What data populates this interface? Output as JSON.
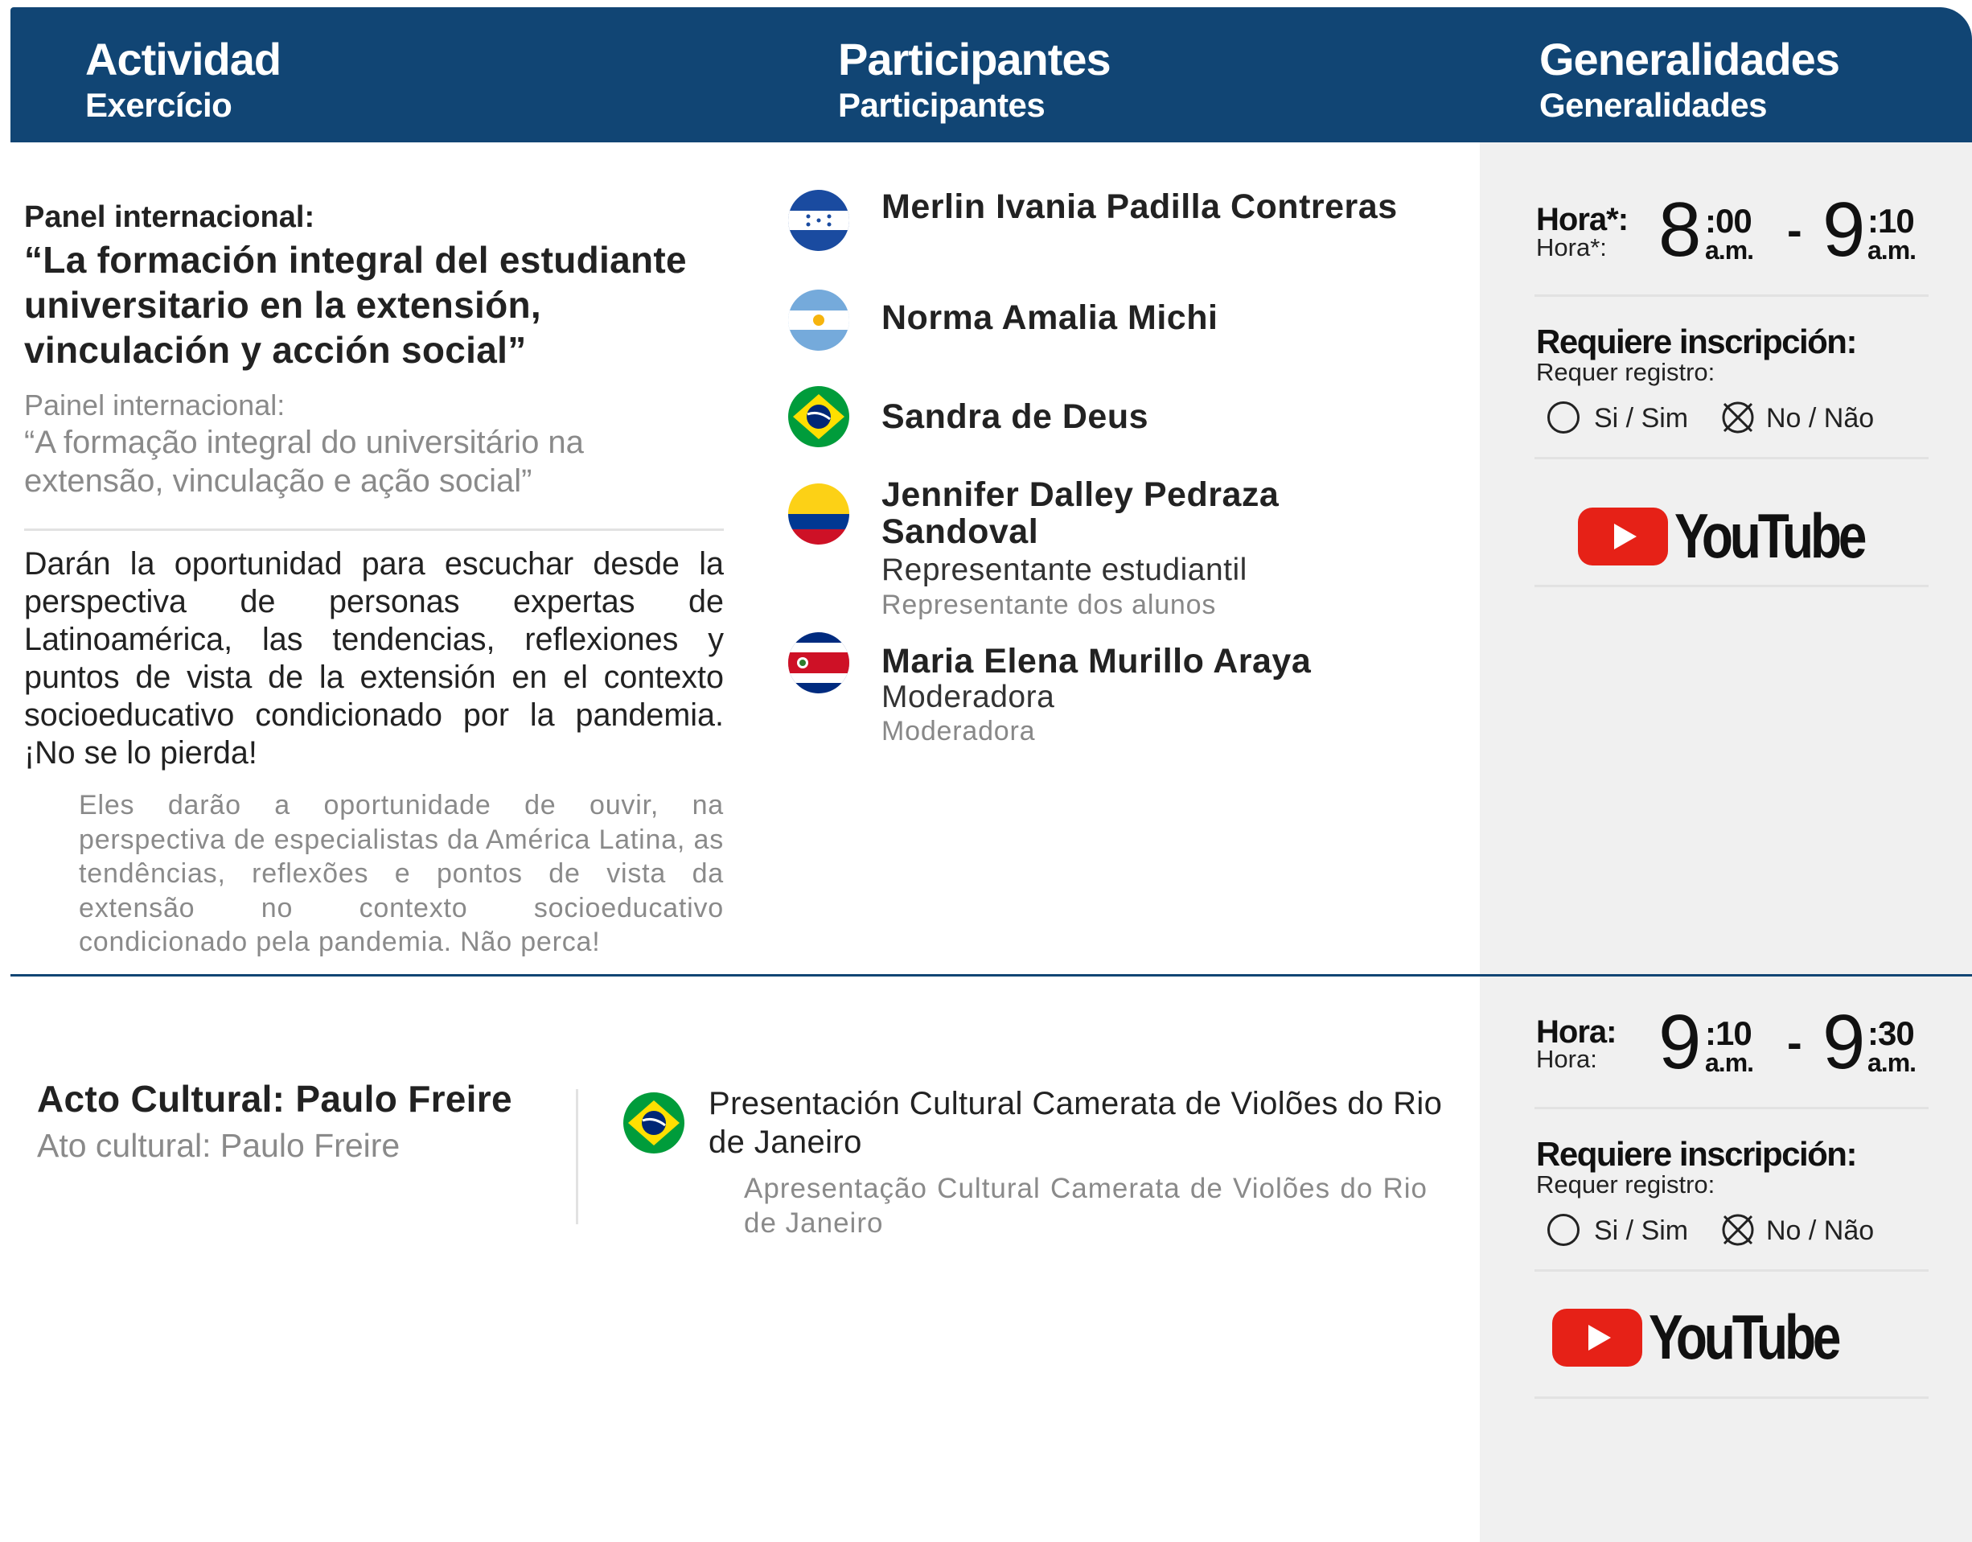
{
  "header": {
    "col1": {
      "title": "Actividad",
      "subtitle": "Exercício"
    },
    "col2": {
      "title": "Participantes",
      "subtitle": "Participantes"
    },
    "col3": {
      "title": "Generalidades",
      "subtitle": "Generalidades"
    }
  },
  "event1": {
    "type_es": "Panel internacional:",
    "title_es": "“La formación integral del estudiante universitario en la extensión, vinculación y acción social”",
    "type_pt": "Painel internacional:",
    "title_pt": "“A formação integral do universitário na extensão, vinculação e ação social”",
    "desc_es": "Darán la oportunidad para escuchar desde la perspectiva de personas expertas de Latinoamérica, las tendencias, reflexiones y puntos de vista de la extensión en el contexto socioeducativo condicionado por la pandemia. ¡No se lo pierda!",
    "desc_pt": "Eles darão a oportunidade de ouvir, na perspectiva de especialistas da América Latina, as tendências, reflexões e pontos de vista da extensão no contexto socioeducativo condicionado pela pandemia. Não perca!",
    "participants": [
      {
        "name": "Merlin Ivania Padilla Contreras",
        "flag": "honduras-flag-icon"
      },
      {
        "name": "Norma Amalia Michi",
        "flag": "argentina-flag-icon"
      },
      {
        "name": "Sandra de Deus",
        "flag": "brazil-flag-icon"
      },
      {
        "name": "Jennifer Dalley Pedraza Sandoval",
        "role_es": "Representante estudiantil",
        "role_pt": "Representante dos alunos",
        "flag": "colombia-flag-icon"
      },
      {
        "name": "Maria Elena Murillo Araya",
        "role_es": "Moderadora",
        "role_pt": "Moderadora",
        "flag": "costa-rica-flag-icon"
      }
    ],
    "hora_label": "Hora*:",
    "hora_sub": "Hora*:",
    "start": {
      "hour": "8",
      "minutes": ":00",
      "ampm": "a.m."
    },
    "end": {
      "hour": "9",
      "minutes": ":10",
      "ampm": "a.m."
    },
    "dash": "-",
    "req_label": "Requiere inscripción:",
    "req_sub": "Requer registro:",
    "opt_yes": "Si / Sim",
    "opt_no": "No / Não",
    "selected": "no",
    "youtube": "YouTube"
  },
  "event2": {
    "title_es": "Acto Cultural: Paulo Freire",
    "title_pt": "Ato cultural: Paulo Freire",
    "presentation_es": "Presentación Cultural Camerata de Violões do Rio de Janeiro",
    "presentation_pt": "Apresentação Cultural Camerata de Violões do Rio de Janeiro",
    "flag": "brazil-flag-icon",
    "hora_label": "Hora:",
    "hora_sub": "Hora:",
    "start": {
      "hour": "9",
      "minutes": ":10",
      "ampm": "a.m."
    },
    "end": {
      "hour": "9",
      "minutes": ":30",
      "ampm": "a.m."
    },
    "dash": "-",
    "req_label": "Requiere inscripción:",
    "req_sub": "Requer registro:",
    "opt_yes": "Si / Sim",
    "opt_no": "No / Não",
    "selected": "no",
    "youtube": "YouTube"
  },
  "colors": {
    "header_bg": "#114574",
    "divider": "#114574",
    "side_bg": "#f0f0f0",
    "youtube_red": "#e62117"
  }
}
